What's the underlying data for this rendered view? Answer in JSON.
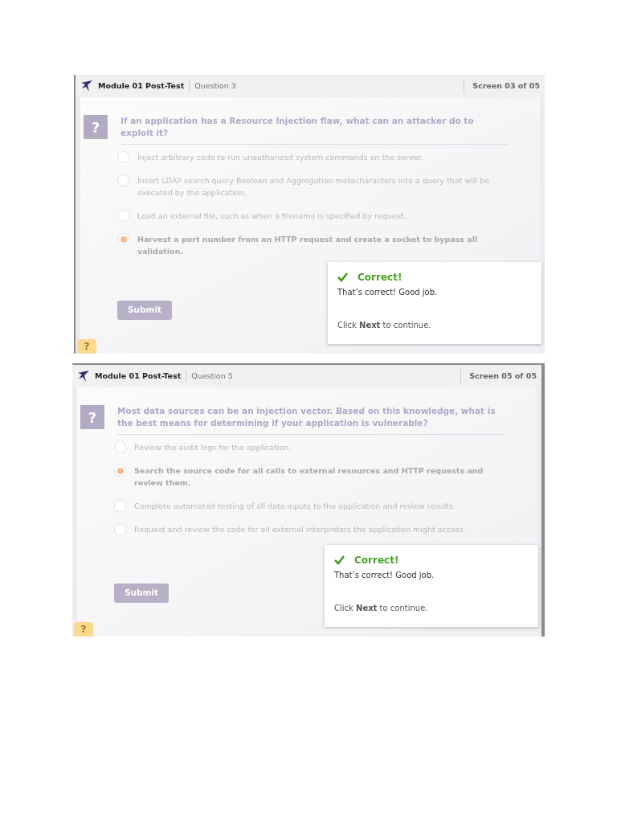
{
  "screens": [
    {
      "module": "Module 01 Post-Test",
      "question_label": "Question 3",
      "screen_label": "Screen 03 of 05",
      "help_icon": "?",
      "question": "If an application has a Resource Injection flaw, what can an attacker do to exploit it?",
      "options": [
        {
          "text": "Inject arbitrary code to run unauthorized system commands on the server.",
          "selected": false
        },
        {
          "text": "Insert LDAP search query Boolean and Aggregation metacharacters into a query that will be executed by the application.",
          "selected": false
        },
        {
          "text": "Load an external file, such as when a filename is specified by request.",
          "selected": false
        },
        {
          "text": "Harvest a port number from an HTTP request and create a socket to bypass all validation.",
          "selected": true
        }
      ],
      "submit": "Submit",
      "feedback": {
        "title": "Correct!",
        "message": "That’s correct! Good job.",
        "hint": "Click **Next** to continue."
      },
      "help_tab": "?"
    },
    {
      "module": "Module 01 Post-Test",
      "question_label": "Question 5",
      "screen_label": "Screen 05 of 05",
      "help_icon": "?",
      "question": "Most data sources can be an injection vector. Based on this knowledge, what is the best means for determining if your application is vulnerable?",
      "options": [
        {
          "text": "Review the audit logs for the application.",
          "selected": false
        },
        {
          "text": "Search the source code for all calls to external resources and HTTP requests and review them.",
          "selected": true
        },
        {
          "text": "Complete automated testing of all data inputs to the application and review results.",
          "selected": false
        },
        {
          "text": "Request and review the code for all external interpreters the application might access.",
          "selected": false
        }
      ],
      "submit": "Submit",
      "feedback": {
        "title": "Correct!",
        "message": "That’s correct! Good job.",
        "hint": "Click **Next** to continue."
      },
      "help_tab": "?"
    }
  ]
}
